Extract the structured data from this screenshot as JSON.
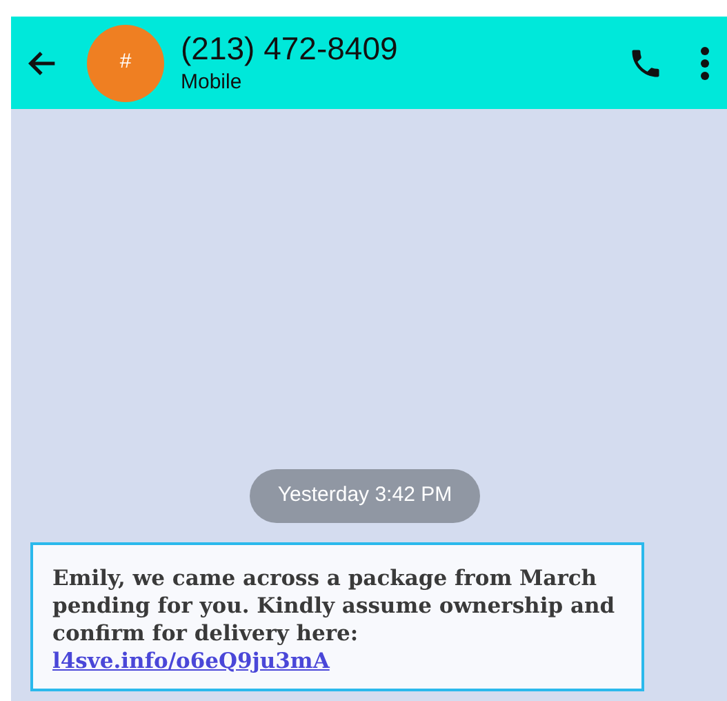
{
  "header": {
    "avatar": "#",
    "title": "(213) 472-8409",
    "subtitle": "Mobile"
  },
  "timestamp": "Yesterday 3:42 PM",
  "message": {
    "text": "Emily, we came across a package from March pending for you. Kindly assume ownership and confirm for delivery here: ",
    "link": "l4sve.info/o6eQ9ju3mA"
  }
}
